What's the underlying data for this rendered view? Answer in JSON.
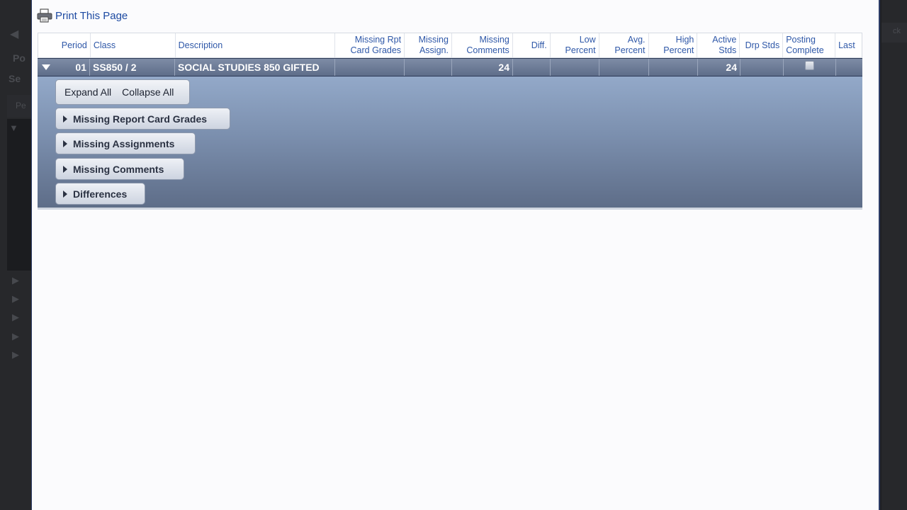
{
  "toolbar": {
    "print_label": "Print This Page"
  },
  "background": {
    "partial_labels": [
      "Po",
      "Se",
      "Pe",
      "ck"
    ]
  },
  "grid": {
    "columns": [
      {
        "label": "Period",
        "align": "r"
      },
      {
        "label": "Class",
        "align": "l"
      },
      {
        "label": "Description",
        "align": "l"
      },
      {
        "label": "Missing Rpt Card Grades",
        "align": "r"
      },
      {
        "label": "Missing Assign.",
        "align": "r"
      },
      {
        "label": "Missing Comments",
        "align": "r"
      },
      {
        "label": "Diff.",
        "align": "r"
      },
      {
        "label": "Low Percent",
        "align": "r"
      },
      {
        "label": "Avg. Percent",
        "align": "r"
      },
      {
        "label": "High Percent",
        "align": "r"
      },
      {
        "label": "Active Stds",
        "align": "r"
      },
      {
        "label": "Drp Stds",
        "align": "r"
      },
      {
        "label": "Posting Complete",
        "align": "l"
      },
      {
        "label": "Last",
        "align": "l"
      }
    ],
    "row": {
      "period": "01",
      "class": "SS850 / 2",
      "description": "SOCIAL STUDIES 850 GIFTED",
      "missing_rpt_card_grades": "",
      "missing_assign": "",
      "missing_comments": "24",
      "diff": "",
      "low_percent": "",
      "avg_percent": "",
      "high_percent": "",
      "active_stds": "24",
      "drp_stds": "",
      "posting_complete": false,
      "last": ""
    }
  },
  "detail": {
    "expand_all": "Expand All",
    "collapse_all": "Collapse All",
    "sections": [
      "Missing Report Card Grades",
      "Missing Assignments",
      "Missing Comments",
      "Differences"
    ]
  }
}
